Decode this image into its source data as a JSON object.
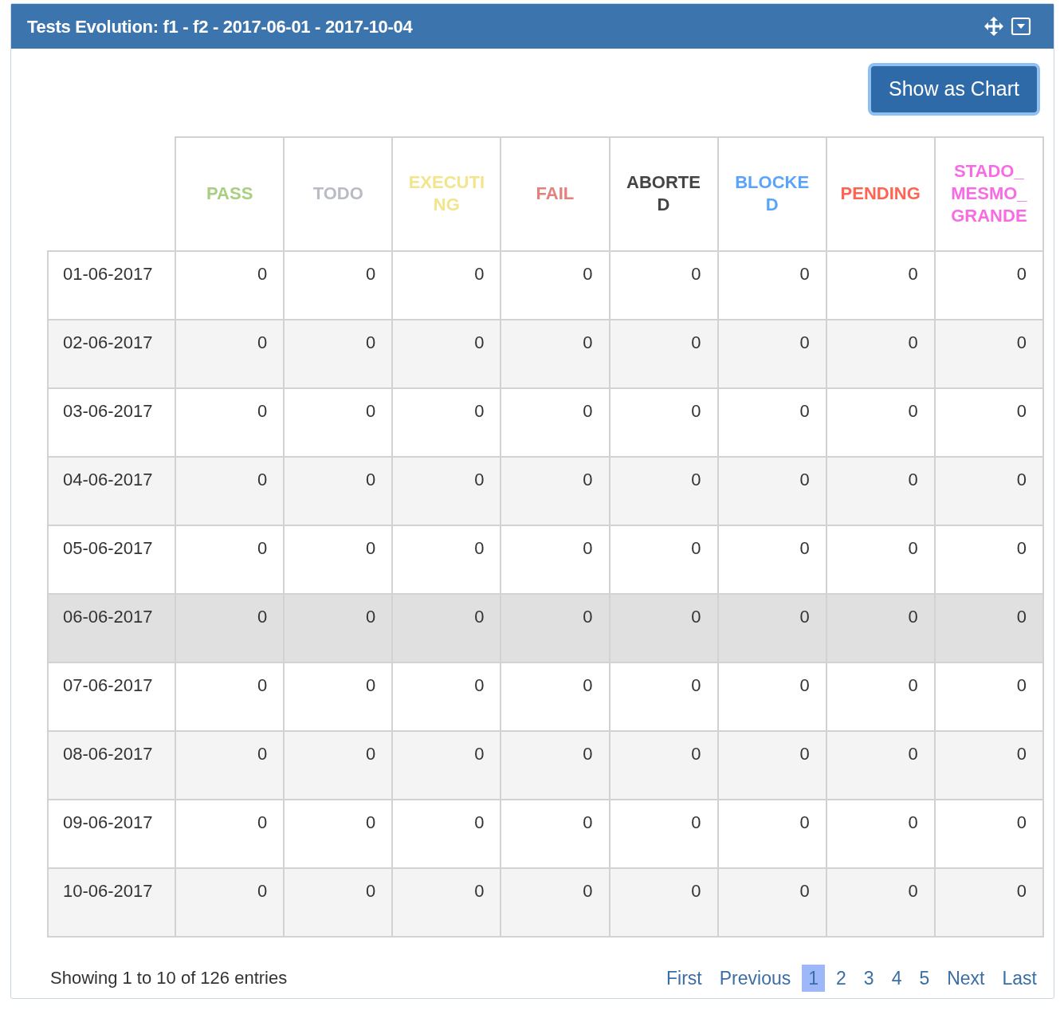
{
  "panel": {
    "title": "Tests Evolution: f1 - f2 - 2017-06-01 - 2017-10-04"
  },
  "show_chart_button": "Show as Chart",
  "table": {
    "columns": [
      {
        "label": "PASS",
        "color": "#a9cf82"
      },
      {
        "label": "TODO",
        "color": "#b9bcc4"
      },
      {
        "label": "EXECUTING",
        "color": "#f3e58c"
      },
      {
        "label": "FAIL",
        "color": "#e0827d"
      },
      {
        "label": "ABORTED",
        "color": "#444444"
      },
      {
        "label": "BLOCKED",
        "color": "#5ba4fb"
      },
      {
        "label": "PENDING",
        "color": "#fd6451"
      },
      {
        "label": "STADO_MESMO_GRANDE",
        "color": "#f76ce3"
      }
    ],
    "rows": [
      {
        "date": "01-06-2017",
        "selected": false,
        "values": [
          "0",
          "0",
          "0",
          "0",
          "0",
          "0",
          "0",
          "0"
        ]
      },
      {
        "date": "02-06-2017",
        "selected": false,
        "values": [
          "0",
          "0",
          "0",
          "0",
          "0",
          "0",
          "0",
          "0"
        ]
      },
      {
        "date": "03-06-2017",
        "selected": false,
        "values": [
          "0",
          "0",
          "0",
          "0",
          "0",
          "0",
          "0",
          "0"
        ]
      },
      {
        "date": "04-06-2017",
        "selected": false,
        "values": [
          "0",
          "0",
          "0",
          "0",
          "0",
          "0",
          "0",
          "0"
        ]
      },
      {
        "date": "05-06-2017",
        "selected": false,
        "values": [
          "0",
          "0",
          "0",
          "0",
          "0",
          "0",
          "0",
          "0"
        ]
      },
      {
        "date": "06-06-2017",
        "selected": true,
        "values": [
          "0",
          "0",
          "0",
          "0",
          "0",
          "0",
          "0",
          "0"
        ]
      },
      {
        "date": "07-06-2017",
        "selected": false,
        "values": [
          "0",
          "0",
          "0",
          "0",
          "0",
          "0",
          "0",
          "0"
        ]
      },
      {
        "date": "08-06-2017",
        "selected": false,
        "values": [
          "0",
          "0",
          "0",
          "0",
          "0",
          "0",
          "0",
          "0"
        ]
      },
      {
        "date": "09-06-2017",
        "selected": false,
        "values": [
          "0",
          "0",
          "0",
          "0",
          "0",
          "0",
          "0",
          "0"
        ]
      },
      {
        "date": "10-06-2017",
        "selected": false,
        "values": [
          "0",
          "0",
          "0",
          "0",
          "0",
          "0",
          "0",
          "0"
        ]
      }
    ]
  },
  "info": "Showing 1 to 10 of 126 entries",
  "pagination": [
    {
      "label": "First",
      "selected": false
    },
    {
      "label": "Previous",
      "selected": false
    },
    {
      "label": "1",
      "selected": true
    },
    {
      "label": "2",
      "selected": false
    },
    {
      "label": "3",
      "selected": false
    },
    {
      "label": "4",
      "selected": false
    },
    {
      "label": "5",
      "selected": false
    },
    {
      "label": "Next",
      "selected": false
    },
    {
      "label": "Last",
      "selected": false
    }
  ]
}
